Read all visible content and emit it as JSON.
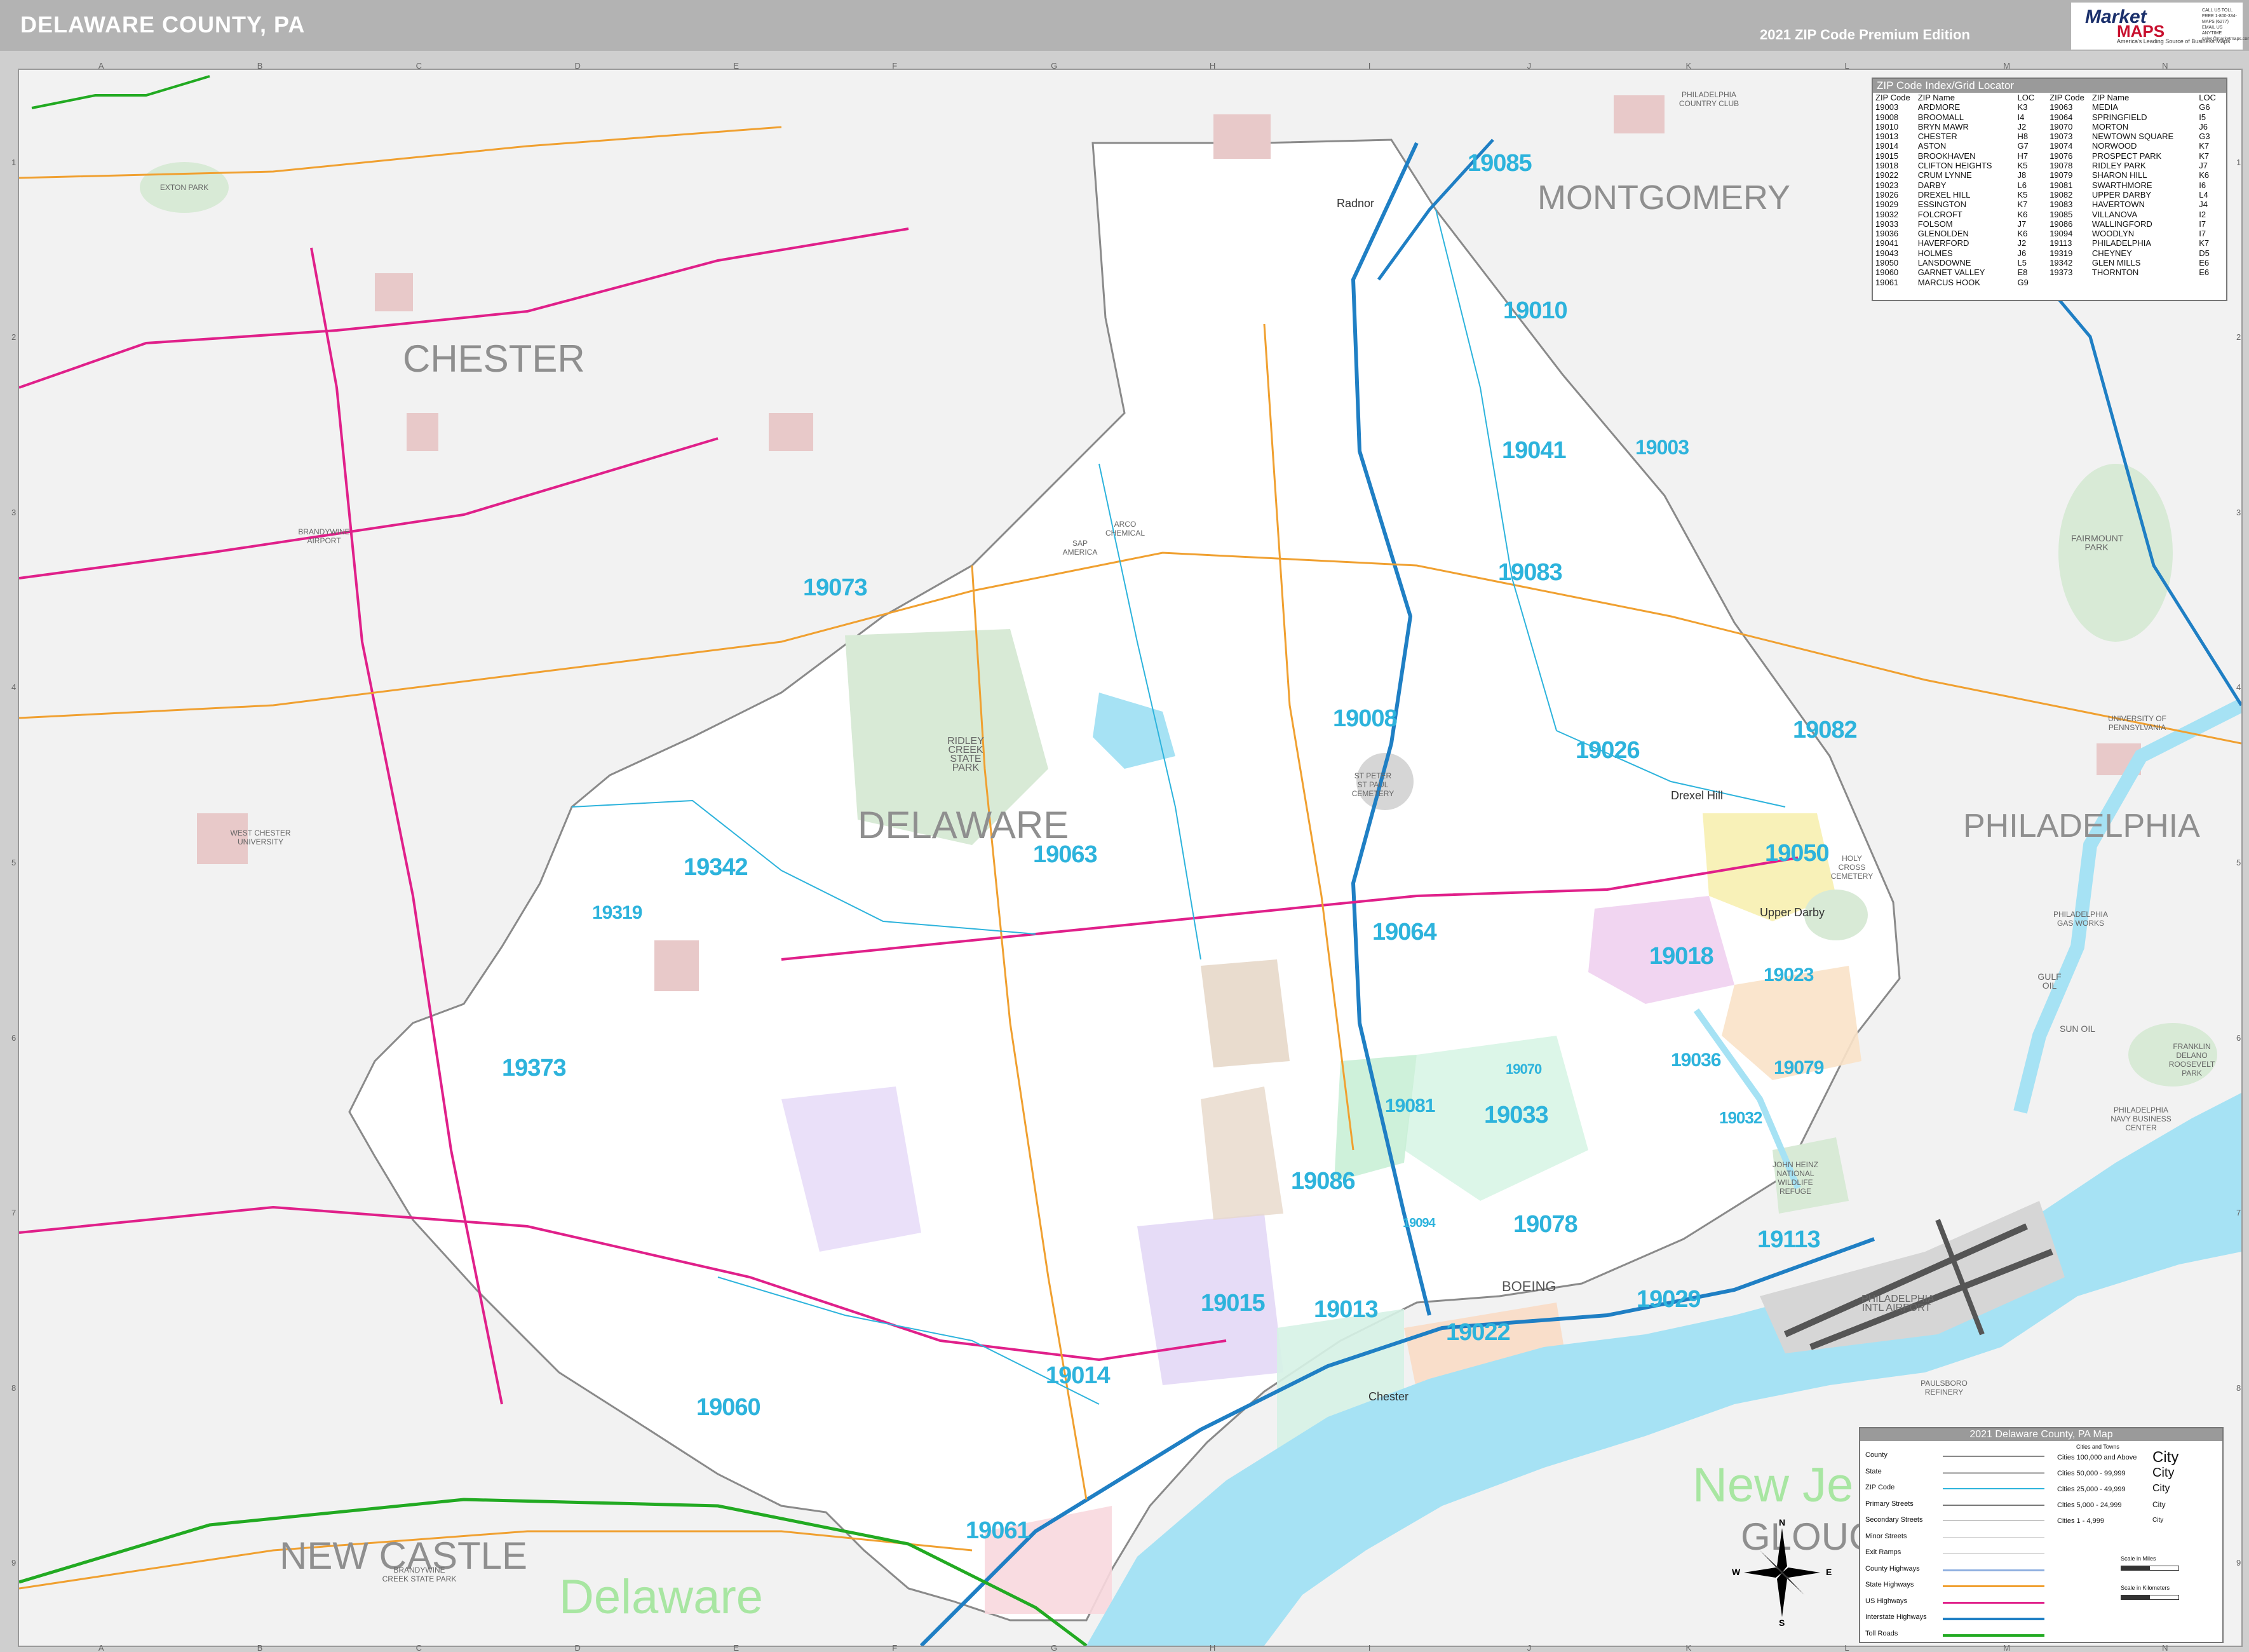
{
  "header": {
    "title": "DELAWARE COUNTY, PA",
    "edition": "2021 ZIP Code Premium Edition",
    "logo": {
      "brand_top": "Market",
      "brand_bottom": "MAPS",
      "tagline": "America's Leading Source of Business Maps",
      "phone": "CALL US TOLL FREE 1-800-334-MAPS (6277) EMAIL US ANYTIME sales@marketmaps.com"
    }
  },
  "grid": {
    "columns": [
      "A",
      "B",
      "C",
      "D",
      "E",
      "F",
      "G",
      "H",
      "I",
      "J",
      "K",
      "L",
      "M",
      "N"
    ],
    "rows": [
      "1",
      "2",
      "3",
      "4",
      "5",
      "6",
      "7",
      "8",
      "9"
    ]
  },
  "zip_index": {
    "title": "ZIP Code Index/Grid Locator",
    "headers": [
      "ZIP Code",
      "ZIP Name",
      "LOC",
      "ZIP Code",
      "ZIP Name",
      "LOC"
    ],
    "rows": [
      [
        "19003",
        "ARDMORE",
        "K3",
        "19063",
        "MEDIA",
        "G6"
      ],
      [
        "19008",
        "BROOMALL",
        "I4",
        "19064",
        "SPRINGFIELD",
        "I5"
      ],
      [
        "19010",
        "BRYN MAWR",
        "J2",
        "19070",
        "MORTON",
        "J6"
      ],
      [
        "19013",
        "CHESTER",
        "H8",
        "19073",
        "NEWTOWN SQUARE",
        "G3"
      ],
      [
        "19014",
        "ASTON",
        "G7",
        "19074",
        "NORWOOD",
        "K7"
      ],
      [
        "19015",
        "BROOKHAVEN",
        "H7",
        "19076",
        "PROSPECT PARK",
        "K7"
      ],
      [
        "19018",
        "CLIFTON HEIGHTS",
        "K5",
        "19078",
        "RIDLEY PARK",
        "J7"
      ],
      [
        "19022",
        "CRUM LYNNE",
        "J8",
        "19079",
        "SHARON HILL",
        "K6"
      ],
      [
        "19023",
        "DARBY",
        "L6",
        "19081",
        "SWARTHMORE",
        "I6"
      ],
      [
        "19026",
        "DREXEL HILL",
        "K5",
        "19082",
        "UPPER DARBY",
        "L4"
      ],
      [
        "19029",
        "ESSINGTON",
        "K7",
        "19083",
        "HAVERTOWN",
        "J4"
      ],
      [
        "19032",
        "FOLCROFT",
        "K6",
        "19085",
        "VILLANOVA",
        "I2"
      ],
      [
        "19033",
        "FOLSOM",
        "J7",
        "19086",
        "WALLINGFORD",
        "I7"
      ],
      [
        "19036",
        "GLENOLDEN",
        "K6",
        "19094",
        "WOODLYN",
        "I7"
      ],
      [
        "19041",
        "HAVERFORD",
        "J2",
        "19113",
        "PHILADELPHIA",
        "K7"
      ],
      [
        "19043",
        "HOLMES",
        "J6",
        "19319",
        "CHEYNEY",
        "D5"
      ],
      [
        "19050",
        "LANSDOWNE",
        "L5",
        "19342",
        "GLEN MILLS",
        "E6"
      ],
      [
        "19060",
        "GARNET VALLEY",
        "E8",
        "19373",
        "THORNTON",
        "E6"
      ],
      [
        "19061",
        "MARCUS HOOK",
        "G9",
        "",
        "",
        " "
      ]
    ]
  },
  "legend": {
    "title": "2021 Delaware County, PA Map",
    "cities_title": "Cities and Towns",
    "items": [
      "County",
      "State",
      "ZIP Code",
      "Primary Streets",
      "Secondary Streets",
      "Minor Streets",
      "Exit Ramps",
      "County Highways",
      "State Highways",
      "US Highways",
      "Interstate Highways",
      "Toll Roads"
    ],
    "city_classes": [
      "Cities 100,000 and Above",
      "Cities 50,000 - 99,999",
      "Cities 25,000 - 49,999",
      "Cities 5,000 - 24,999",
      "Cities 1 - 4,999"
    ],
    "city_symbol": "City",
    "scale_miles": "Scale in Miles",
    "scale_km": "Scale in Kilometers",
    "compass": [
      "N",
      "S",
      "E",
      "W"
    ],
    "colors": {
      "interstate": "#1f7fc4",
      "us_hwy": "#e0208a",
      "state_hwy": "#f0a030",
      "county_hwy": "#8fb0e0",
      "toll": "#22aa22",
      "zip": "#2db3dc",
      "water": "#a6e2f4"
    }
  },
  "labels": {
    "counties": [
      "CHESTER",
      "MONTGOMERY",
      "DELAWARE",
      "PHILADELPHIA",
      "NEW CASTLE",
      "GLOUC"
    ],
    "states": [
      "Delaware",
      "New Je"
    ],
    "zips": [
      "19085",
      "19010",
      "19041",
      "19003",
      "19073",
      "19083",
      "19008",
      "19026",
      "19082",
      "19342",
      "19063",
      "19319",
      "19050",
      "19064",
      "19018",
      "19023",
      "19373",
      "19070",
      "19036",
      "19079",
      "19081",
      "19033",
      "19032",
      "19086",
      "19094",
      "19078",
      "19113",
      "19015",
      "19013",
      "19022",
      "19029",
      "19014",
      "19060",
      "19061"
    ],
    "places": [
      "Radnor",
      "Drexel Hill",
      "Upper Darby",
      "Chester",
      "BOEING"
    ],
    "pois": [
      "EXTON PARK",
      "BRANDYWINE AIRPORT",
      "RIDLEY CREEK STATE PARK",
      "ARCO CHEMICAL",
      "SAP AMERICA",
      "PHILADELPHIA COUNTRY CLUB",
      "FAIRMOUNT PARK",
      "HOLY CROSS CEMETERY",
      "PHILADELPHIA GAS WORKS",
      "GULF OIL",
      "SUN OIL",
      "FRANKLIN DELANO ROOSEVELT PARK",
      "PHILADELPHIA NAVY BUSINESS CENTER",
      "JOHN HEINZ NATIONAL WILDLIFE REFUGE",
      "PHILADELPHIA INTL AIRPORT",
      "PAULSBORO REFINERY",
      "BRANDYWINE CREEK STATE PARK",
      "ST PETER ST PAUL CEMETERY",
      "UNIVERSITY OF PENNSYLVANIA",
      "WEST CHESTER UNIVERSITY"
    ]
  }
}
